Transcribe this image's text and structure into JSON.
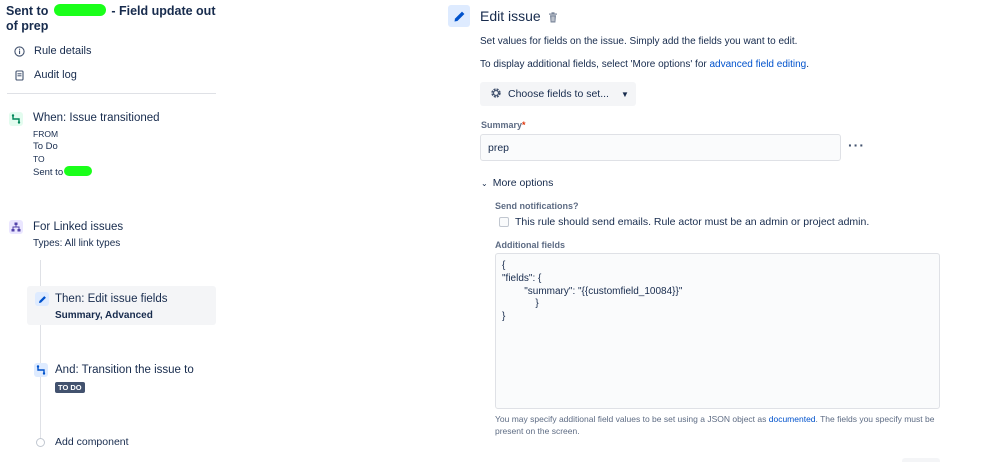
{
  "rule": {
    "title_prefix": "Sent to",
    "title_suffix": "- Field update out of prep"
  },
  "left_menu": [
    {
      "label": "Rule details",
      "icon": "info-icon"
    },
    {
      "label": "Audit log",
      "icon": "document-icon"
    }
  ],
  "components": {
    "when": {
      "title": "When: Issue transitioned",
      "from_label": "FROM",
      "from_value": "To Do",
      "to_label": "TO",
      "to_value": "Sent to"
    },
    "linked": {
      "title": "For Linked issues",
      "subtitle": "Types: All link types"
    },
    "then": {
      "title": "Then: Edit issue fields",
      "subtitle": "Summary, Advanced"
    },
    "and": {
      "title": "And: Transition the issue to",
      "status": "TO DO"
    },
    "add": {
      "label": "Add component"
    }
  },
  "editor": {
    "title": "Edit issue",
    "desc1": "Set values for fields on the issue. Simply add the fields you want to edit.",
    "desc2_prefix": "To display additional fields, select 'More options' for ",
    "desc2_link": "advanced field editing",
    "desc2_suffix": ".",
    "choose_label": "Choose fields to set...",
    "summary_label": "Summary",
    "summary_required": "*",
    "summary_value": "prep",
    "more_options": "More options",
    "notifications_label": "Send notifications?",
    "notifications_checkbox": "This rule should send emails. Rule actor must be an admin or project admin.",
    "additional_label": "Additional fields",
    "json_lines": [
      "{",
      "\"fields\": {",
      "        \"summary\": \"{{customfield_10084}}\"",
      "            }",
      "}"
    ],
    "help_prefix": "You may specify additional field values to be set using a JSON object as ",
    "help_link": "documented",
    "help_suffix": ". The fields you specify must be present on the screen."
  }
}
